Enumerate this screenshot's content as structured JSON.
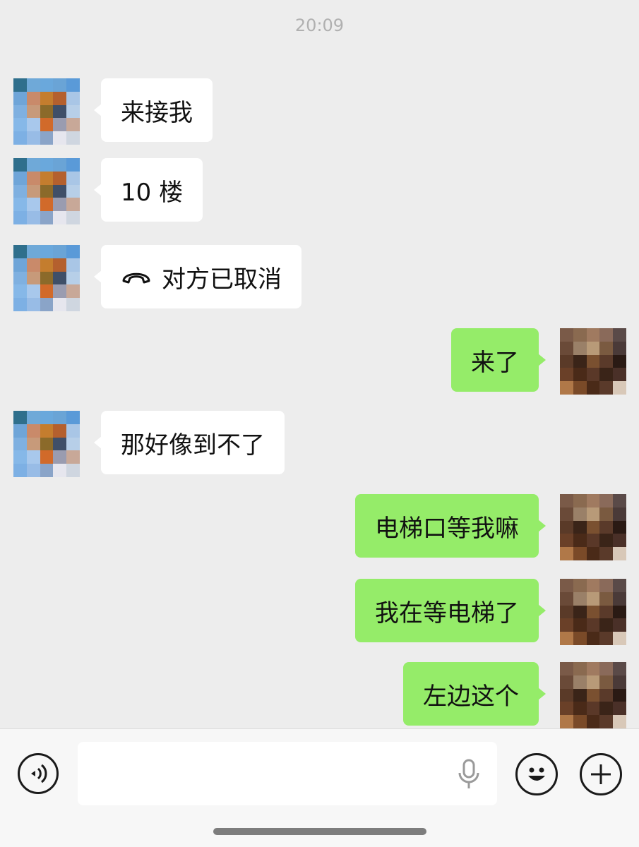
{
  "chat": {
    "timestamp": "20:09",
    "messages": [
      {
        "dir": "in",
        "text": "来接我",
        "call": false,
        "avatar": "friend"
      },
      {
        "dir": "in",
        "text": "10 楼",
        "call": false,
        "avatar": "friend"
      },
      {
        "dir": "in",
        "text": "对方已取消",
        "call": true,
        "avatar": "friend"
      },
      {
        "dir": "out",
        "text": "来了",
        "call": false,
        "avatar": "self"
      },
      {
        "dir": "in",
        "text": "那好像到不了",
        "call": false,
        "avatar": "friend"
      },
      {
        "dir": "out",
        "text": "电梯口等我嘛",
        "call": false,
        "avatar": "self"
      },
      {
        "dir": "out",
        "text": "我在等电梯了",
        "call": false,
        "avatar": "self"
      },
      {
        "dir": "out",
        "text": "左边这个",
        "call": false,
        "avatar": "self"
      }
    ]
  },
  "input_bar": {
    "text_value": "",
    "icons": [
      "voice-mode-icon",
      "microphone-icon",
      "emoji-icon",
      "plus-icon"
    ]
  },
  "colors": {
    "background": "#ededed",
    "incoming_bubble": "#ffffff",
    "outgoing_bubble": "#95ec69",
    "timestamp_text": "#b0b0b0",
    "input_bar": "#f7f7f7"
  },
  "avatars": {
    "friend": [
      "#2f6f8c",
      "#6fa9d8",
      "#6aa8dc",
      "#6aa4d6",
      "#5a9ad8",
      "#6fa5d8",
      "#c98a6a",
      "#c47d2e",
      "#b4602e",
      "#a9c6e6",
      "#7fb0e0",
      "#c79a7a",
      "#8b6a2a",
      "#3f4f68",
      "#b7cfe8",
      "#86b8e8",
      "#a8c8ec",
      "#d16a2a",
      "#9a9cb0",
      "#c8a898",
      "#7db0e4",
      "#98bce6",
      "#8aa4c8",
      "#e6e6ee",
      "#cfd6e0"
    ],
    "self": [
      "#7a5a48",
      "#8a6a50",
      "#a07a60",
      "#8a6a5a",
      "#5a4a48",
      "#6a4a38",
      "#9a8068",
      "#b89a78",
      "#7a5a40",
      "#4a3a38",
      "#5a3a28",
      "#3a2418",
      "#7a5030",
      "#5a3a2a",
      "#2a1a14",
      "#6a4028",
      "#4a2a18",
      "#5a3828",
      "#3a2418",
      "#4a3028",
      "#b07848",
      "#7a4a28",
      "#4a2a18",
      "#5a3a2a",
      "#d8c8b8"
    ]
  }
}
